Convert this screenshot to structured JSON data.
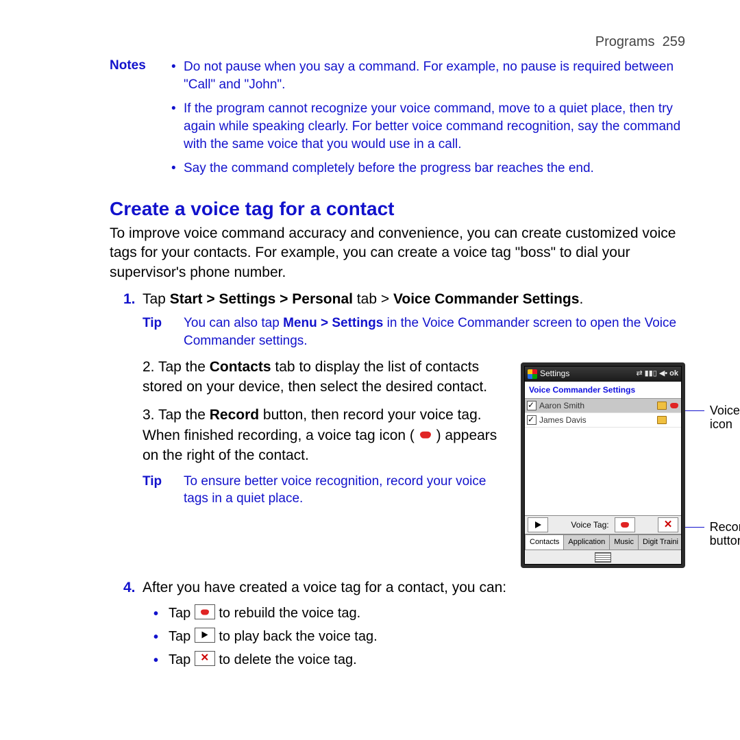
{
  "header": {
    "section": "Programs",
    "page": "259"
  },
  "notes": {
    "label": "Notes",
    "items": [
      "Do not pause when you say a command. For example, no pause is required between \"Call\" and \"John\".",
      "If the program cannot recognize your voice command, move to a quiet place, then try again while speaking clearly. For better voice command recognition, say the command with the same voice that you would use in a call.",
      "Say the command completely before the progress bar reaches the end."
    ]
  },
  "heading": "Create a voice tag for a contact",
  "intro": "To improve voice command accuracy and convenience, you can create customized voice tags for your contacts. For example, you can create a voice tag \"boss\" to dial your supervisor's phone number.",
  "steps": {
    "s1_pre": "Tap ",
    "s1_bold": "Start > Settings > Personal",
    "s1_mid": " tab > ",
    "s1_bold2": "Voice Commander Settings",
    "s1_post": ".",
    "tip1_label": "Tip",
    "tip1_pre": "You can also tap ",
    "tip1_bold": "Menu > Settings",
    "tip1_post": " in the Voice Commander screen to open the Voice Commander settings.",
    "s2_pre": "Tap the ",
    "s2_bold": "Contacts",
    "s2_post": " tab to display the list of contacts stored on your device, then select the desired contact.",
    "s3_pre": "Tap the ",
    "s3_bold": "Record",
    "s3_post": " button, then record your voice tag.",
    "s3_line2a": "When finished recording, a voice tag icon (",
    "s3_line2b": ") appears on the right of the contact.",
    "tip2_label": "Tip",
    "tip2_text": "To ensure better voice recognition, record your voice tags in a quiet place.",
    "s4_text": "After you have created a voice tag for a contact, you can:",
    "s4_b1a": "Tap ",
    "s4_b1b": " to rebuild the voice tag.",
    "s4_b2a": "Tap ",
    "s4_b2b": " to play back the voice tag.",
    "s4_b3a": "Tap ",
    "s4_b3b": " to delete the voice tag."
  },
  "device": {
    "titlebar_label": "Settings",
    "ok": "ok",
    "subtitle": "Voice Commander Settings",
    "contacts": [
      {
        "name": "Aaron Smith",
        "selected": true,
        "has_tag": true
      },
      {
        "name": "James Davis",
        "selected": false,
        "has_tag": false
      }
    ],
    "voice_tag_label": "Voice Tag:",
    "tabs": [
      "Contacts",
      "Application",
      "Music",
      "Digit Traini"
    ]
  },
  "callouts": {
    "icon_label": "Voice tag icon",
    "record_label": "Record button"
  }
}
